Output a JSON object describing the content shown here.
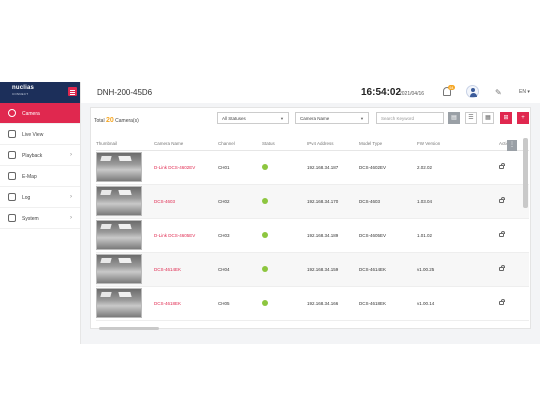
{
  "sidebar": {
    "logo": "nuclias",
    "logo_sub": "CONNECT",
    "items": [
      {
        "label": "Camera",
        "active": true
      },
      {
        "label": "Live View",
        "active": false
      },
      {
        "label": "Playback",
        "active": false
      },
      {
        "label": "E-Map",
        "active": false
      },
      {
        "label": "Log",
        "active": false
      },
      {
        "label": "System",
        "active": false
      }
    ]
  },
  "header": {
    "device": "DNH-200-45D6",
    "time": "16:54:02",
    "date": "2021/04/16",
    "notif_count": "64",
    "lang": "EN"
  },
  "toolbar": {
    "total_prefix": "Total",
    "total_count": "20",
    "total_suffix": "Camera(s)",
    "status_filter": "All Statuses",
    "sort_field": "Camera Name",
    "search_placeholder": "Search Keyword"
  },
  "table": {
    "headers": [
      "Thumbnail",
      "Camera Name",
      "Channel",
      "Status",
      "IPv4 Address",
      "Model Type",
      "FW Version",
      "Action"
    ],
    "rows": [
      {
        "name": "D-Link DCS-4602EV",
        "channel": "CH01",
        "ip": "192.168.34.187",
        "model": "DCS-4602EV",
        "fw": "2.02.02"
      },
      {
        "name": "DCS-4603",
        "channel": "CH02",
        "ip": "192.168.34.170",
        "model": "DCS-4603",
        "fw": "1.03.04"
      },
      {
        "name": "D-Link DCS-4605EV",
        "channel": "CH03",
        "ip": "192.168.34.189",
        "model": "DCS-4605EV",
        "fw": "1.01.02"
      },
      {
        "name": "DCS-4614EK",
        "channel": "CH04",
        "ip": "192.168.34.159",
        "model": "DCS-4614EK",
        "fw": "v1.00.25"
      },
      {
        "name": "DCS-4618EK",
        "channel": "CH05",
        "ip": "192.168.34.166",
        "model": "DCS-4618EK",
        "fw": "v1.00.14"
      }
    ]
  },
  "colors": {
    "accent": "#e0284f",
    "brand": "#1c2f5a",
    "online": "#8dc63f",
    "count": "#f5a623"
  }
}
